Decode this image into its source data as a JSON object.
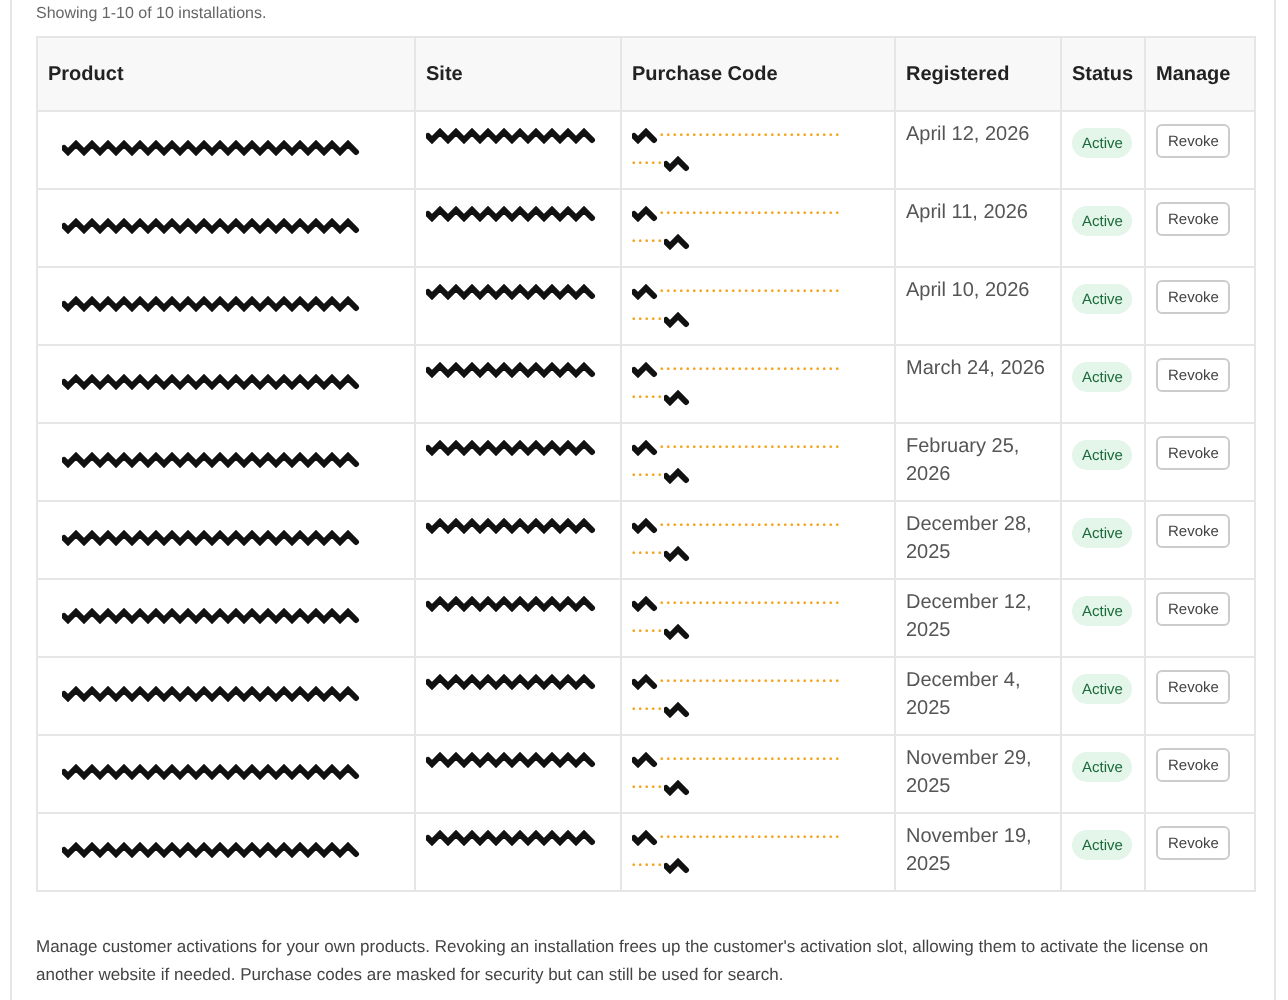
{
  "summary": "Showing 1-10 of 10 installations.",
  "table": {
    "columns": [
      "Product",
      "Site",
      "Purchase Code",
      "Registered",
      "Status",
      "Manage"
    ],
    "rows": [
      {
        "code_start": "••••••••••••••••••••••••••••",
        "code_end": "•••••",
        "registered": "April 12, 2026",
        "status": "Active",
        "action": "Revoke"
      },
      {
        "code_start": "••••••••••••••••••••••••••••",
        "code_end": "•••••",
        "registered": "April 11, 2026",
        "status": "Active",
        "action": "Revoke"
      },
      {
        "code_start": "••••••••••••••••••••••••••••",
        "code_end": "•••••",
        "registered": "April 10, 2026",
        "status": "Active",
        "action": "Revoke"
      },
      {
        "code_start": "••••••••••••••••••••••••••••",
        "code_end": "•••••",
        "registered": "March 24, 2026",
        "status": "Active",
        "action": "Revoke"
      },
      {
        "code_start": "••••••••••••••••••••••••••••",
        "code_end": "•••••",
        "registered": "February 25, 2026",
        "status": "Active",
        "action": "Revoke"
      },
      {
        "code_start": "••••••••••••••••••••••••••••",
        "code_end": "•••••",
        "registered": "December 28, 2025",
        "status": "Active",
        "action": "Revoke"
      },
      {
        "code_start": "••••••••••••••••••••••••••••",
        "code_end": "•••••",
        "registered": "December 12, 2025",
        "status": "Active",
        "action": "Revoke"
      },
      {
        "code_start": "••••••••••••••••••••••••••••",
        "code_end": "•••••",
        "registered": "December 4, 2025",
        "status": "Active",
        "action": "Revoke"
      },
      {
        "code_start": "••••••••••••••••••••••••••••",
        "code_end": "•••••",
        "registered": "November 29, 2025",
        "status": "Active",
        "action": "Revoke"
      },
      {
        "code_start": "••••••••••••••••••••••••••••",
        "code_end": "•••••",
        "registered": "November 19, 2025",
        "status": "Active",
        "action": "Revoke"
      }
    ]
  },
  "footer_note": "Manage customer activations for your own products. Revoking an installation frees up the customer's activation slot, allowing them to activate the license on another website if needed. Purchase codes are masked for security but can still be used for search."
}
